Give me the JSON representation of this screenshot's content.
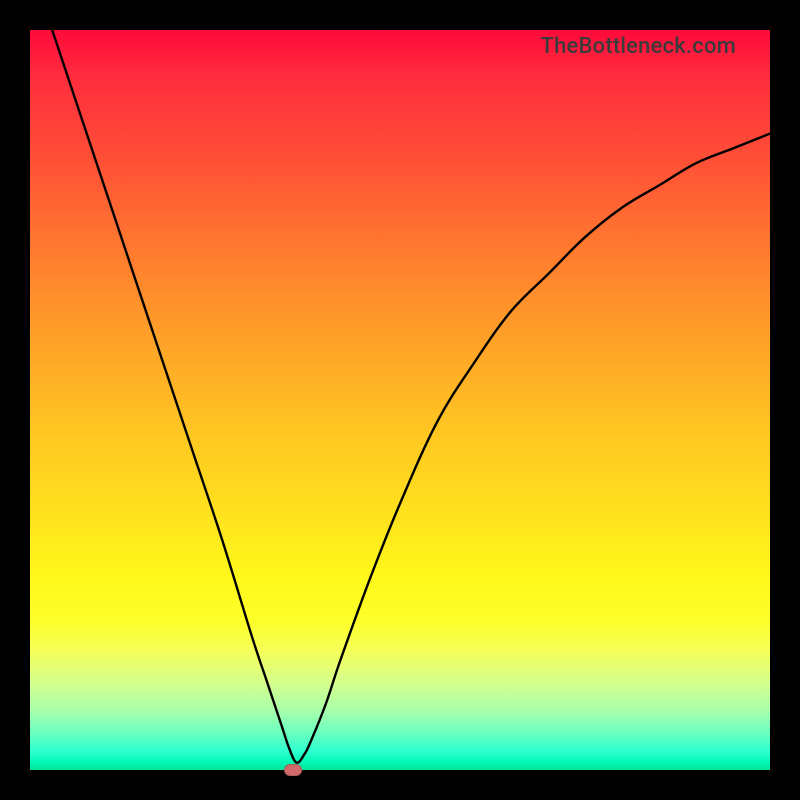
{
  "watermark": "TheBottleneck.com",
  "chart_data": {
    "type": "line",
    "title": "",
    "xlabel": "",
    "ylabel": "",
    "xlim": [
      0,
      100
    ],
    "ylim": [
      0,
      100
    ],
    "legend": false,
    "grid": false,
    "background": "rainbow-gradient-red-to-green",
    "series": [
      {
        "name": "bottleneck-curve",
        "color": "#000000",
        "x": [
          3,
          6,
          10,
          14,
          18,
          22,
          26,
          30,
          32,
          34,
          35,
          36,
          37,
          38,
          40,
          42,
          46,
          50,
          55,
          60,
          65,
          70,
          75,
          80,
          85,
          90,
          95,
          100
        ],
        "y": [
          100,
          91,
          79,
          67,
          55,
          43,
          31,
          18,
          12,
          6,
          3,
          1,
          2,
          4,
          9,
          15,
          26,
          36,
          47,
          55,
          62,
          67,
          72,
          76,
          79,
          82,
          84,
          86
        ]
      }
    ],
    "minimum_marker": {
      "x": 35.5,
      "y": 0,
      "color": "#d06a6a"
    },
    "annotations": []
  }
}
